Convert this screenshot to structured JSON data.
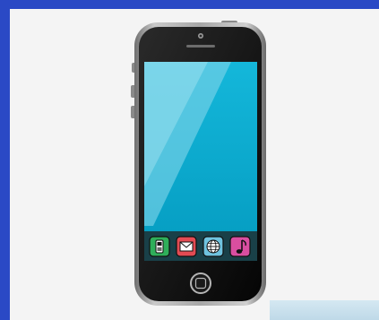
{
  "scene": {
    "subject": "smartphone-illustration",
    "colors": {
      "page_border": "#2a49c5",
      "panel_bg": "#f4f4f4",
      "phone_body": "#101010",
      "phone_rim": "#9b9b9b",
      "screen": "#0aa6c9",
      "screen_glare": "#8fe0f0",
      "dock_bg": "#222222"
    }
  },
  "dock": {
    "icons": [
      {
        "name": "phone-app-icon",
        "color": "#2fae5a"
      },
      {
        "name": "mail-app-icon",
        "color": "#e34b53"
      },
      {
        "name": "browser-app-icon",
        "color": "#6fc3df"
      },
      {
        "name": "music-app-icon",
        "color": "#d94ea0"
      }
    ]
  }
}
